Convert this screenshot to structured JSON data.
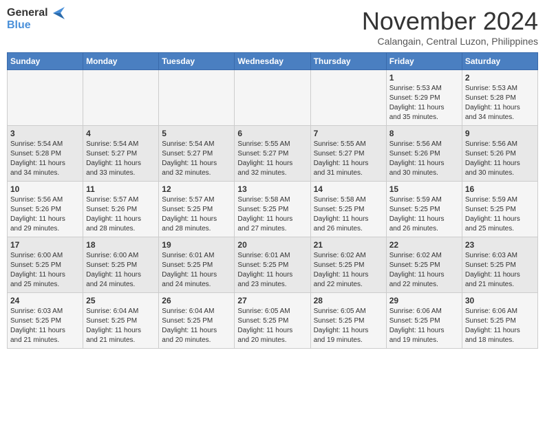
{
  "header": {
    "logo_line1": "General",
    "logo_line2": "Blue",
    "month": "November 2024",
    "location": "Calangain, Central Luzon, Philippines"
  },
  "weekdays": [
    "Sunday",
    "Monday",
    "Tuesday",
    "Wednesday",
    "Thursday",
    "Friday",
    "Saturday"
  ],
  "weeks": [
    [
      {
        "day": "",
        "info": ""
      },
      {
        "day": "",
        "info": ""
      },
      {
        "day": "",
        "info": ""
      },
      {
        "day": "",
        "info": ""
      },
      {
        "day": "",
        "info": ""
      },
      {
        "day": "1",
        "info": "Sunrise: 5:53 AM\nSunset: 5:29 PM\nDaylight: 11 hours\nand 35 minutes."
      },
      {
        "day": "2",
        "info": "Sunrise: 5:53 AM\nSunset: 5:28 PM\nDaylight: 11 hours\nand 34 minutes."
      }
    ],
    [
      {
        "day": "3",
        "info": "Sunrise: 5:54 AM\nSunset: 5:28 PM\nDaylight: 11 hours\nand 34 minutes."
      },
      {
        "day": "4",
        "info": "Sunrise: 5:54 AM\nSunset: 5:27 PM\nDaylight: 11 hours\nand 33 minutes."
      },
      {
        "day": "5",
        "info": "Sunrise: 5:54 AM\nSunset: 5:27 PM\nDaylight: 11 hours\nand 32 minutes."
      },
      {
        "day": "6",
        "info": "Sunrise: 5:55 AM\nSunset: 5:27 PM\nDaylight: 11 hours\nand 32 minutes."
      },
      {
        "day": "7",
        "info": "Sunrise: 5:55 AM\nSunset: 5:27 PM\nDaylight: 11 hours\nand 31 minutes."
      },
      {
        "day": "8",
        "info": "Sunrise: 5:56 AM\nSunset: 5:26 PM\nDaylight: 11 hours\nand 30 minutes."
      },
      {
        "day": "9",
        "info": "Sunrise: 5:56 AM\nSunset: 5:26 PM\nDaylight: 11 hours\nand 30 minutes."
      }
    ],
    [
      {
        "day": "10",
        "info": "Sunrise: 5:56 AM\nSunset: 5:26 PM\nDaylight: 11 hours\nand 29 minutes."
      },
      {
        "day": "11",
        "info": "Sunrise: 5:57 AM\nSunset: 5:26 PM\nDaylight: 11 hours\nand 28 minutes."
      },
      {
        "day": "12",
        "info": "Sunrise: 5:57 AM\nSunset: 5:25 PM\nDaylight: 11 hours\nand 28 minutes."
      },
      {
        "day": "13",
        "info": "Sunrise: 5:58 AM\nSunset: 5:25 PM\nDaylight: 11 hours\nand 27 minutes."
      },
      {
        "day": "14",
        "info": "Sunrise: 5:58 AM\nSunset: 5:25 PM\nDaylight: 11 hours\nand 26 minutes."
      },
      {
        "day": "15",
        "info": "Sunrise: 5:59 AM\nSunset: 5:25 PM\nDaylight: 11 hours\nand 26 minutes."
      },
      {
        "day": "16",
        "info": "Sunrise: 5:59 AM\nSunset: 5:25 PM\nDaylight: 11 hours\nand 25 minutes."
      }
    ],
    [
      {
        "day": "17",
        "info": "Sunrise: 6:00 AM\nSunset: 5:25 PM\nDaylight: 11 hours\nand 25 minutes."
      },
      {
        "day": "18",
        "info": "Sunrise: 6:00 AM\nSunset: 5:25 PM\nDaylight: 11 hours\nand 24 minutes."
      },
      {
        "day": "19",
        "info": "Sunrise: 6:01 AM\nSunset: 5:25 PM\nDaylight: 11 hours\nand 24 minutes."
      },
      {
        "day": "20",
        "info": "Sunrise: 6:01 AM\nSunset: 5:25 PM\nDaylight: 11 hours\nand 23 minutes."
      },
      {
        "day": "21",
        "info": "Sunrise: 6:02 AM\nSunset: 5:25 PM\nDaylight: 11 hours\nand 22 minutes."
      },
      {
        "day": "22",
        "info": "Sunrise: 6:02 AM\nSunset: 5:25 PM\nDaylight: 11 hours\nand 22 minutes."
      },
      {
        "day": "23",
        "info": "Sunrise: 6:03 AM\nSunset: 5:25 PM\nDaylight: 11 hours\nand 21 minutes."
      }
    ],
    [
      {
        "day": "24",
        "info": "Sunrise: 6:03 AM\nSunset: 5:25 PM\nDaylight: 11 hours\nand 21 minutes."
      },
      {
        "day": "25",
        "info": "Sunrise: 6:04 AM\nSunset: 5:25 PM\nDaylight: 11 hours\nand 21 minutes."
      },
      {
        "day": "26",
        "info": "Sunrise: 6:04 AM\nSunset: 5:25 PM\nDaylight: 11 hours\nand 20 minutes."
      },
      {
        "day": "27",
        "info": "Sunrise: 6:05 AM\nSunset: 5:25 PM\nDaylight: 11 hours\nand 20 minutes."
      },
      {
        "day": "28",
        "info": "Sunrise: 6:05 AM\nSunset: 5:25 PM\nDaylight: 11 hours\nand 19 minutes."
      },
      {
        "day": "29",
        "info": "Sunrise: 6:06 AM\nSunset: 5:25 PM\nDaylight: 11 hours\nand 19 minutes."
      },
      {
        "day": "30",
        "info": "Sunrise: 6:06 AM\nSunset: 5:25 PM\nDaylight: 11 hours\nand 18 minutes."
      }
    ]
  ]
}
